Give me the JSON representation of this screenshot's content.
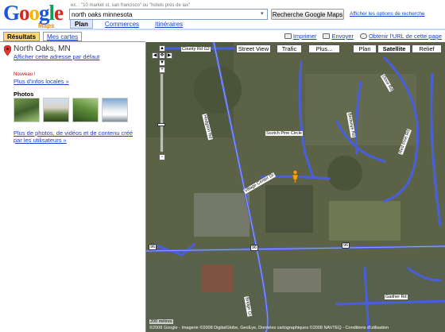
{
  "header": {
    "logo_text": "Google",
    "logo_sub": "Maps",
    "hint": "ex. : \"10 market st, san francisco\" ou \"hotels près de lax\"",
    "search_value": "north oaks minnesota",
    "search_button": "Recherche Google Maps",
    "options_link": "Afficher les options de recherche",
    "tabs": [
      "Plan",
      "Commerces",
      "Itinéraires"
    ]
  },
  "left_tabs": {
    "results": "Résultats",
    "my_maps": "Mes cartes"
  },
  "actions": {
    "print": "Imprimer",
    "send": "Envoyer",
    "link": "Obtenir l'URL de cette page"
  },
  "result": {
    "name": "North Oaks, MN",
    "default_address_link": "Afficher cette adresse par défaut",
    "new_label": "Nouveau !",
    "local_info_link": "Plus d'infos locales »",
    "photos_heading": "Photos",
    "more_link": "Plus de photos, de vidéos et de contenu créé par les utilisateurs »"
  },
  "map": {
    "buttons": [
      "Street View",
      "Trafic",
      "Plus...",
      "Plan",
      "Satellite",
      "Relief"
    ],
    "selected": "Satellite",
    "copyright": "©2008 Google - Imagerie ©2008 DigitalGlobe, GeoEye, Données cartographiques ©2008 NAVTEQ - Conditions d'utilisation",
    "scale": "200 mètres",
    "road_labels": {
      "county_rd": "County Rd G2",
      "hodgson": "Hodgson Rd",
      "scotch_pine": "Scotch Pine Circle",
      "village_center": "Village Center Dr",
      "rt96": "96",
      "bridge": "Bridge Ct",
      "gaither": "Gaither Rd",
      "birdseye": "Birdseye Rd",
      "red_pine": "Red Pine Rd",
      "dove_rd": "Dove Rd"
    }
  },
  "colors": {
    "accent": "#1a3fc0",
    "tab_active": "#ffd976",
    "road": "#4a5fd6",
    "rule": "#c3d9ff"
  }
}
